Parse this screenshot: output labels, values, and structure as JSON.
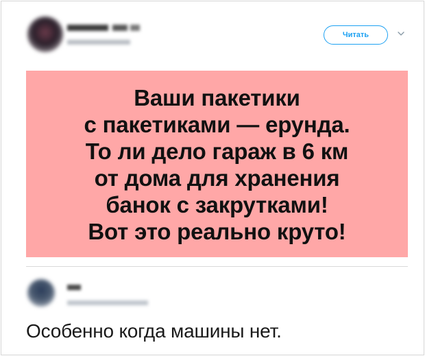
{
  "tweet": {
    "follow_label": "Читать",
    "quote_lines": [
      "Ваши пакетики",
      "с пакетиками — ерунда.",
      "То ли дело гараж в 6 км",
      "от дома для хранения",
      "банок с закрутками!",
      "Вот это реально круто!"
    ],
    "quote_bg_color": "#ffa7a7",
    "follow_color": "#1da1f2"
  },
  "reply": {
    "text": "Особенно когда машины нет."
  }
}
